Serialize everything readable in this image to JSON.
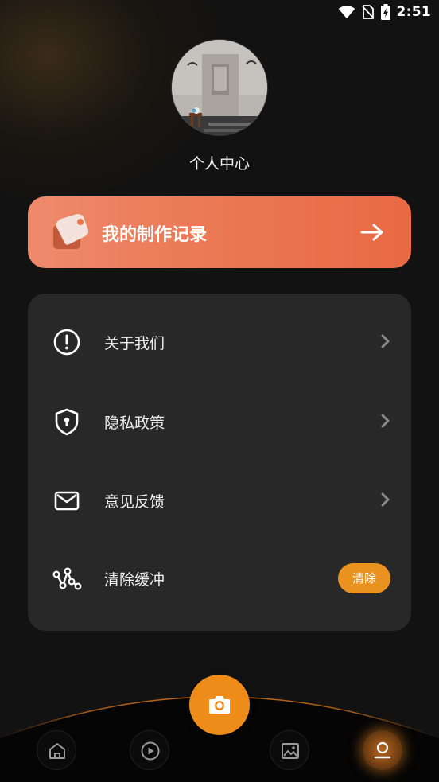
{
  "status_bar": {
    "time": "2:51",
    "icons": [
      "wifi-icon",
      "no-sim-icon",
      "battery-charging-icon"
    ]
  },
  "profile": {
    "avatar": "avatar-image",
    "title": "个人中心"
  },
  "records_card": {
    "label": "我的制作记录",
    "icon": "tag-icon",
    "arrow": "arrow-right-icon",
    "colors": {
      "start": "#ee8a6c",
      "end": "#e96a45"
    }
  },
  "menu": {
    "items": [
      {
        "label": "关于我们",
        "icon": "info-circle-icon",
        "trailing": "chevron-right-icon"
      },
      {
        "label": "隐私政策",
        "icon": "shield-lock-icon",
        "trailing": "chevron-right-icon"
      },
      {
        "label": "意见反馈",
        "icon": "mail-icon",
        "trailing": "chevron-right-icon"
      },
      {
        "label": "清除缓冲",
        "icon": "nodes-icon",
        "trailing_button": "清除"
      }
    ]
  },
  "bottom_nav": {
    "items": [
      {
        "icon": "home-icon",
        "active": false
      },
      {
        "icon": "play-icon",
        "active": false
      },
      {
        "icon": "camera-icon",
        "active": false,
        "primary": true
      },
      {
        "icon": "image-icon",
        "active": false
      },
      {
        "icon": "user-icon",
        "active": true
      }
    ],
    "accent": "#ee8c1a"
  }
}
